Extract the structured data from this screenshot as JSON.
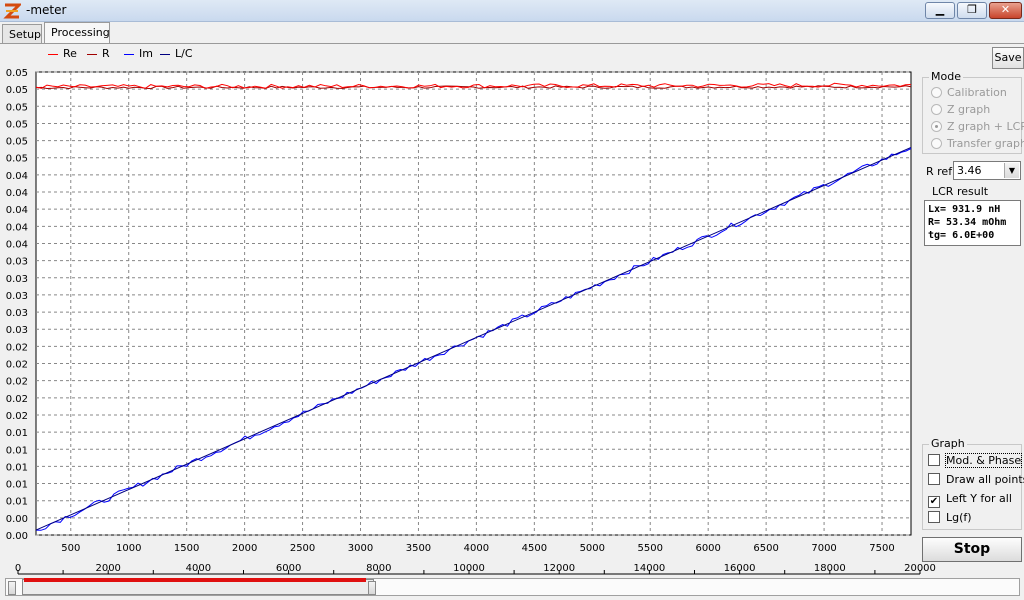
{
  "window": {
    "title": "-meter",
    "min_label": "▁",
    "max_label": "❐",
    "close_label": "✕"
  },
  "tabs": [
    {
      "label": "Setup"
    },
    {
      "label": "Processing"
    }
  ],
  "legend": [
    {
      "label": "Re",
      "color": "#ff0000"
    },
    {
      "label": "R",
      "color": "#a00000"
    },
    {
      "label": "Im",
      "color": "#0000ff"
    },
    {
      "label": "L/C",
      "color": "#000080"
    }
  ],
  "save_label": "Save",
  "mode": {
    "title": "Mode",
    "options": [
      {
        "label": "Calibration",
        "selected": false
      },
      {
        "label": "Z graph",
        "selected": false
      },
      {
        "label": "Z graph + LCR",
        "selected": true
      },
      {
        "label": "Transfer graph",
        "selected": false
      }
    ]
  },
  "rref": {
    "label": "R ref",
    "value": "3.46"
  },
  "lcr": {
    "title": "LCR result",
    "lines": [
      "Lx= 931.9 nH",
      "R= 53.34 mOhm",
      "tg= 6.0E+00"
    ]
  },
  "graph": {
    "title": "Graph",
    "options": [
      {
        "label": "Mod. & Phase",
        "checked": false
      },
      {
        "label": "Draw all points",
        "checked": false
      },
      {
        "label": "Left Y for all",
        "checked": true
      },
      {
        "label": "Lg(f)",
        "checked": false
      }
    ]
  },
  "stop_label": "Stop",
  "chart_data": {
    "type": "line",
    "x_range": [
      200,
      7750
    ],
    "x_ticks": [
      500,
      1000,
      1500,
      2000,
      2500,
      3000,
      3500,
      4000,
      4500,
      5000,
      5500,
      6000,
      6500,
      7000,
      7500
    ],
    "y_tick_labels": [
      "0.05",
      "0.05",
      "0.05",
      "0.05",
      "0.05",
      "0.05",
      "0.04",
      "0.04",
      "0.04",
      "0.04",
      "0.04",
      "0.03",
      "0.03",
      "0.03",
      "0.03",
      "0.03",
      "0.02",
      "0.02",
      "0.02",
      "0.02",
      "0.02",
      "0.01",
      "0.01",
      "0.01",
      "0.01",
      "0.01",
      "0.00",
      "0.00"
    ],
    "y_range": [
      -0.001,
      0.0555
    ],
    "grid": true,
    "series": [
      {
        "name": "Re",
        "color": "#ff0000",
        "x": [
          200,
          7750
        ],
        "y": [
          0.0537,
          0.0539
        ]
      },
      {
        "name": "R",
        "color": "#a00000",
        "x": [
          200,
          7750
        ],
        "y": [
          0.0536,
          0.0537
        ]
      },
      {
        "name": "Im",
        "color": "#0000ff",
        "x": [
          200,
          7750
        ],
        "y": [
          -0.0004,
          0.0463
        ]
      },
      {
        "name": "L/C",
        "color": "#000080",
        "x": [
          200,
          7750
        ],
        "y": [
          -0.0004,
          0.0463
        ]
      }
    ],
    "freq_scale": {
      "range": [
        0,
        20000
      ],
      "ticks": [
        0,
        2000,
        4000,
        6000,
        8000,
        10000,
        12000,
        14000,
        16000,
        18000,
        20000
      ]
    },
    "view_range": {
      "start_fraction": 0.0,
      "end_fraction": 0.355
    }
  }
}
